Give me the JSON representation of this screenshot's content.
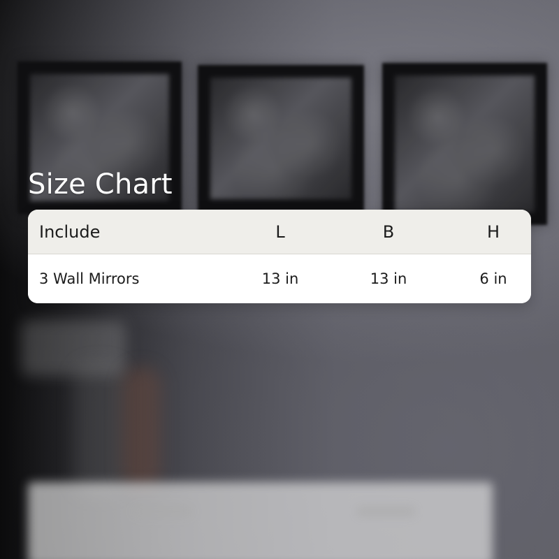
{
  "title": "Size Chart",
  "table": {
    "headers": [
      "Include",
      "L",
      "B",
      "H"
    ],
    "rows": [
      {
        "include": "3 Wall Mirrors",
        "L": "13 in",
        "B": "13 in",
        "H": "6 in"
      }
    ]
  },
  "colors": {
    "title": "#ffffff",
    "card_bg": "#ffffff",
    "header_bg": "#efeeea",
    "text": "#1b1b1b"
  }
}
